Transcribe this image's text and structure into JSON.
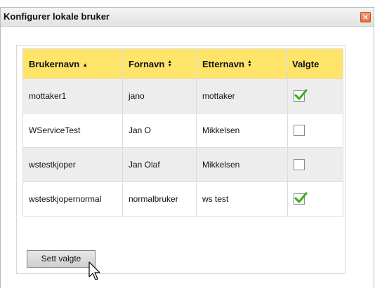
{
  "dialog": {
    "title": "Konfigurer lokale bruker",
    "close_icon": "close-icon",
    "close_color": "#e76d3f"
  },
  "table": {
    "header_color": "#ffe46a",
    "columns": [
      {
        "label": "Brukernavn",
        "sort": "ascending"
      },
      {
        "label": "Fornavn",
        "sort": "sortable"
      },
      {
        "label": "Etternavn",
        "sort": "sortable"
      },
      {
        "label": "Valgte",
        "sort": "none"
      }
    ],
    "rows": [
      {
        "brukernavn": "mottaker1",
        "fornavn": "jano",
        "etternavn": "mottaker",
        "valgt": true
      },
      {
        "brukernavn": "WServiceTest",
        "fornavn": "Jan O",
        "etternavn": "Mikkelsen",
        "valgt": false
      },
      {
        "brukernavn": "wstestkjoper",
        "fornavn": "Jan Olaf",
        "etternavn": "Mikkelsen",
        "valgt": false
      },
      {
        "brukernavn": "wstestkjopernormal",
        "fornavn": "normalbruker",
        "etternavn": "ws test",
        "valgt": true
      }
    ],
    "check_color": "#3cb31e"
  },
  "actions": {
    "set_selected_label": "Sett valgte"
  }
}
